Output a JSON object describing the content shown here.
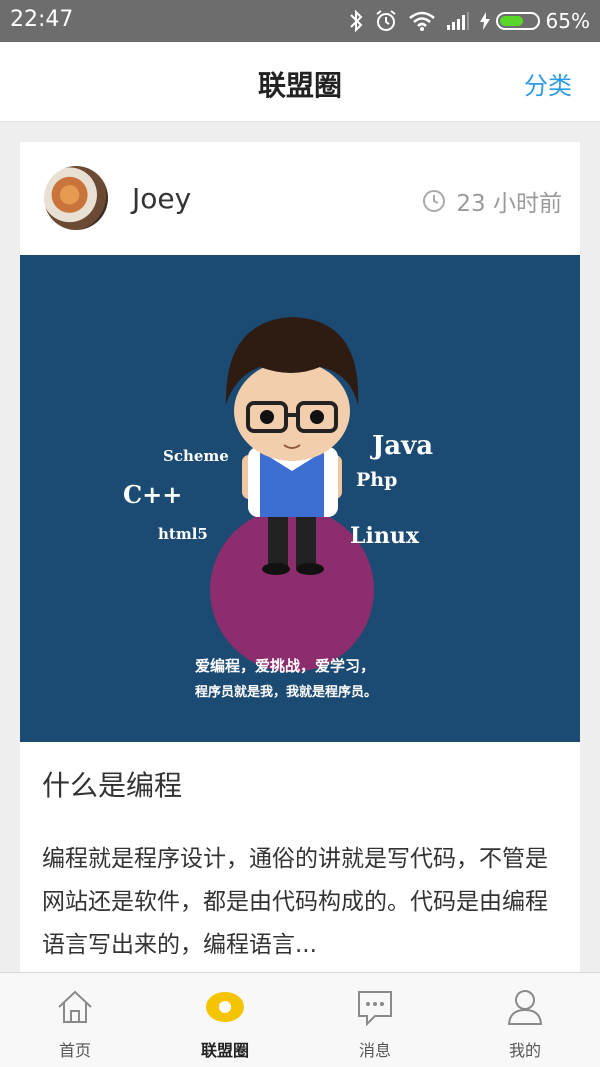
{
  "status_bar": {
    "time": "22:47",
    "battery": "65%",
    "battery_level": 0.65
  },
  "header": {
    "title": "联盟圈",
    "action": "分类"
  },
  "post": {
    "author": "Joey",
    "time": "23 小时前",
    "image_text": {
      "langs": [
        "Scheme",
        "C++",
        "html5",
        "Java",
        "Php",
        "Linux"
      ],
      "caption_line1": "爱编程，爱挑战，爱学习，",
      "caption_line2": "程序员就是我，我就是程序员。"
    },
    "title": "什么是编程",
    "body": "编程就是程序设计，通俗的讲就是写代码，不管是网站还是软件，都是由代码构成的。代码是由编程语言写出来的，编程语言..."
  },
  "tabs": [
    {
      "label": "首页",
      "icon": "home-icon",
      "active": false
    },
    {
      "label": "联盟圈",
      "icon": "circle-icon",
      "active": true
    },
    {
      "label": "消息",
      "icon": "message-icon",
      "active": false
    },
    {
      "label": "我的",
      "icon": "user-icon",
      "active": false
    }
  ],
  "colors": {
    "accent": "#2e9be6",
    "active_tab": "#f5c400",
    "image_bg": "#1b4a73"
  }
}
